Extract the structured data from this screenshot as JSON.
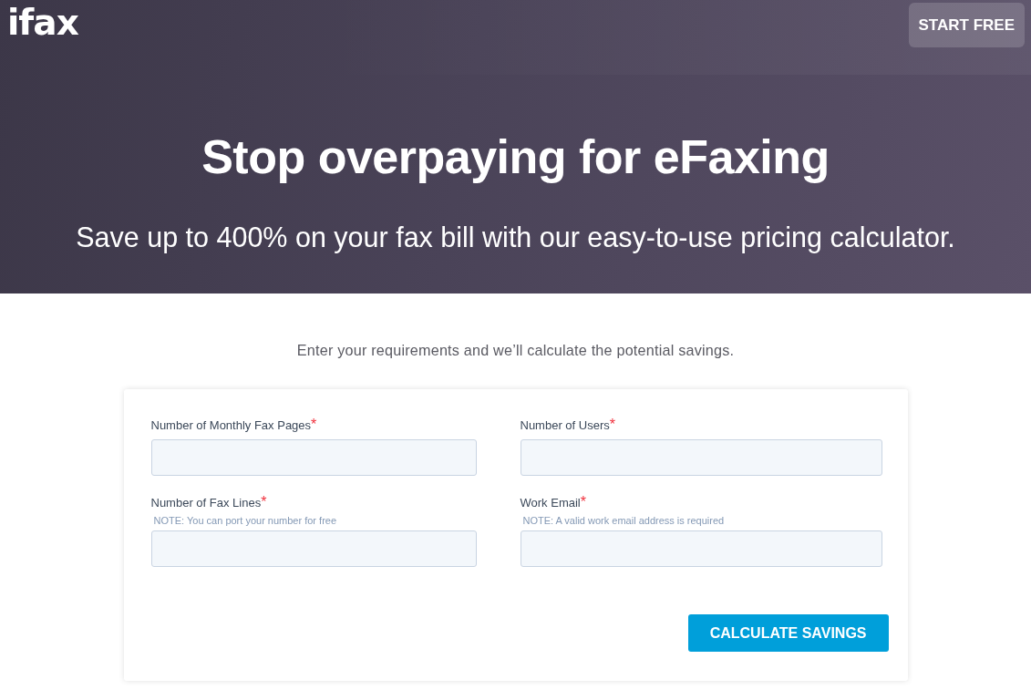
{
  "header": {
    "logo": "ifax",
    "start_button": "START FREE"
  },
  "hero": {
    "title": "Stop overpaying for eFaxing",
    "subtitle": "Save up to 400% on your fax bill with our easy-to-use pricing calculator."
  },
  "calculator": {
    "intro": "Enter your requirements and we’ll calculate the potential savings.",
    "fields": [
      {
        "label": "Number of Monthly Fax Pages",
        "required_mark": "*"
      },
      {
        "label": "Number of Users",
        "required_mark": "*"
      },
      {
        "label": "Number of Fax Lines",
        "required_mark": "*",
        "note": "NOTE: You can port your number for free"
      },
      {
        "label": "Work Email",
        "required_mark": "*",
        "note": "NOTE: A valid work email address is required"
      }
    ],
    "submit_button": "CALCULATE SAVINGS"
  }
}
